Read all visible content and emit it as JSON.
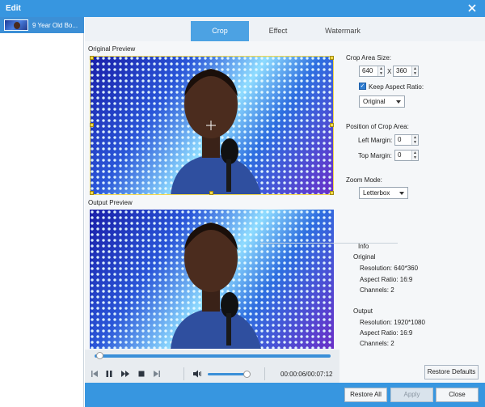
{
  "window": {
    "title": "Edit"
  },
  "sidebar": {
    "items": [
      {
        "label": "9 Year Old Bo..."
      }
    ]
  },
  "tabs": [
    {
      "label": "Crop"
    },
    {
      "label": "Effect"
    },
    {
      "label": "Watermark"
    }
  ],
  "preview": {
    "original_label": "Original Preview",
    "output_label": "Output Preview"
  },
  "player": {
    "time": "00:00:06/00:07:12",
    "seek_progress": 0.02,
    "volume_level": 0.92
  },
  "crop": {
    "area_size_label": "Crop Area Size:",
    "width": "640",
    "x_label": "X",
    "height": "360",
    "keep_aspect_label": "Keep Aspect Ratio:",
    "keep_aspect_checked": true,
    "aspect_selected": "Original",
    "position_label": "Position of Crop Area:",
    "left_margin_label": "Left Margin:",
    "left_margin": "0",
    "top_margin_label": "Top Margin:",
    "top_margin": "0",
    "zoom_mode_label": "Zoom Mode:",
    "zoom_selected": "Letterbox"
  },
  "info": {
    "title": "Info",
    "original": {
      "heading": "Original",
      "resolution": "Resolution: 640*360",
      "aspect": "Aspect Ratio: 16:9",
      "channels": "Channels: 2"
    },
    "output": {
      "heading": "Output",
      "resolution": "Resolution: 1920*1080",
      "aspect": "Aspect Ratio: 16:9",
      "channels": "Channels: 2"
    }
  },
  "buttons": {
    "restore_defaults": "Restore Defaults",
    "restore_all": "Restore All",
    "apply": "Apply",
    "close": "Close"
  },
  "colors": {
    "accent": "#3796e0",
    "tab_active": "#4ca2e3"
  },
  "icons": {
    "close": "close-icon",
    "play_controls": [
      "skip-back-icon",
      "pause-icon",
      "fast-forward-icon",
      "stop-icon",
      "skip-end-icon"
    ],
    "volume": "volume-icon"
  }
}
